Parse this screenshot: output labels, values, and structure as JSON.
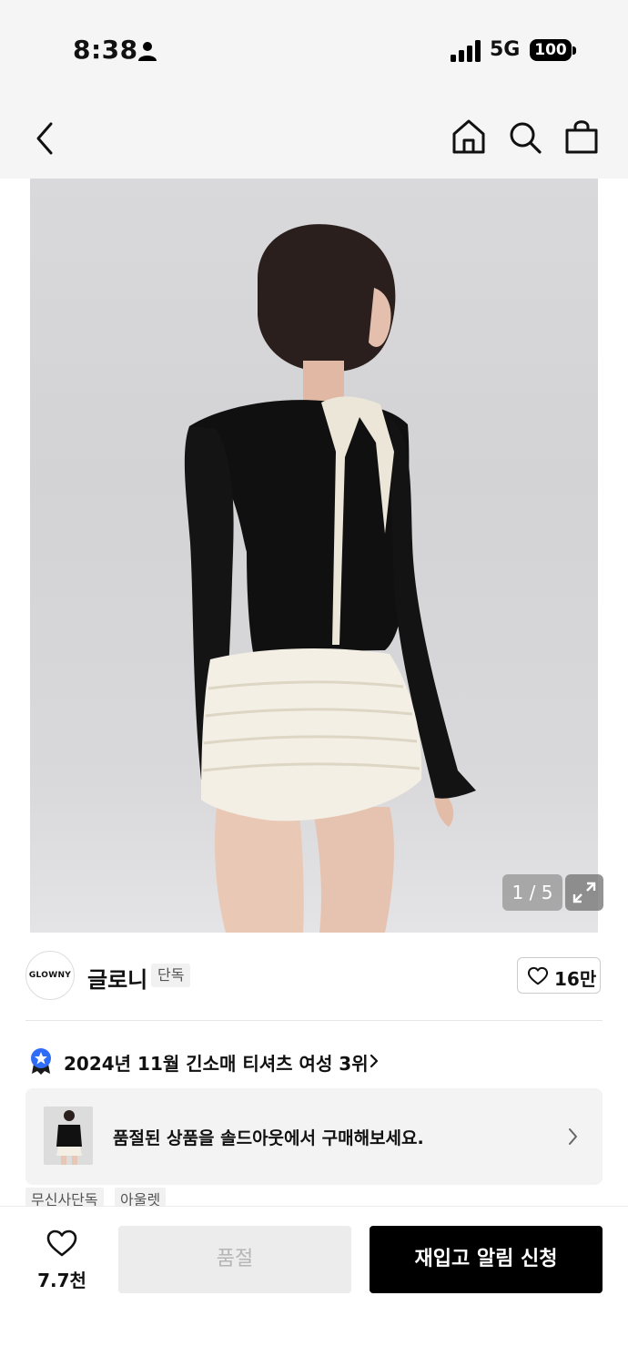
{
  "status_bar": {
    "time": "8:38",
    "network": "5G",
    "battery": "100"
  },
  "header": {
    "back_icon": "chevron-left-icon",
    "home_icon": "home-icon",
    "search_icon": "search-icon",
    "cart_icon": "shopping-bag-icon"
  },
  "gallery": {
    "counter": "1 / 5",
    "current": 1,
    "total": 5,
    "expand_icon": "expand-icon"
  },
  "brand": {
    "logo_text": "GLOWNY",
    "name": "글로니",
    "tag": "단독",
    "likes": "16만"
  },
  "ranking": {
    "text": "2024년 11월 긴소매 티셔츠 여성 3위"
  },
  "promo": {
    "text": "품절된 상품을 솔드아웃에서 구매해보세요."
  },
  "tags": [
    "무신사단독",
    "아울렛"
  ],
  "bottom_bar": {
    "wish_count": "7.7천",
    "soldout_label": "품절",
    "restock_label": "재입고 알림 신청"
  },
  "colors": {
    "primary_button": "#000000",
    "disabled_button": "#ececec",
    "rank_badge": "#2f6df6"
  }
}
